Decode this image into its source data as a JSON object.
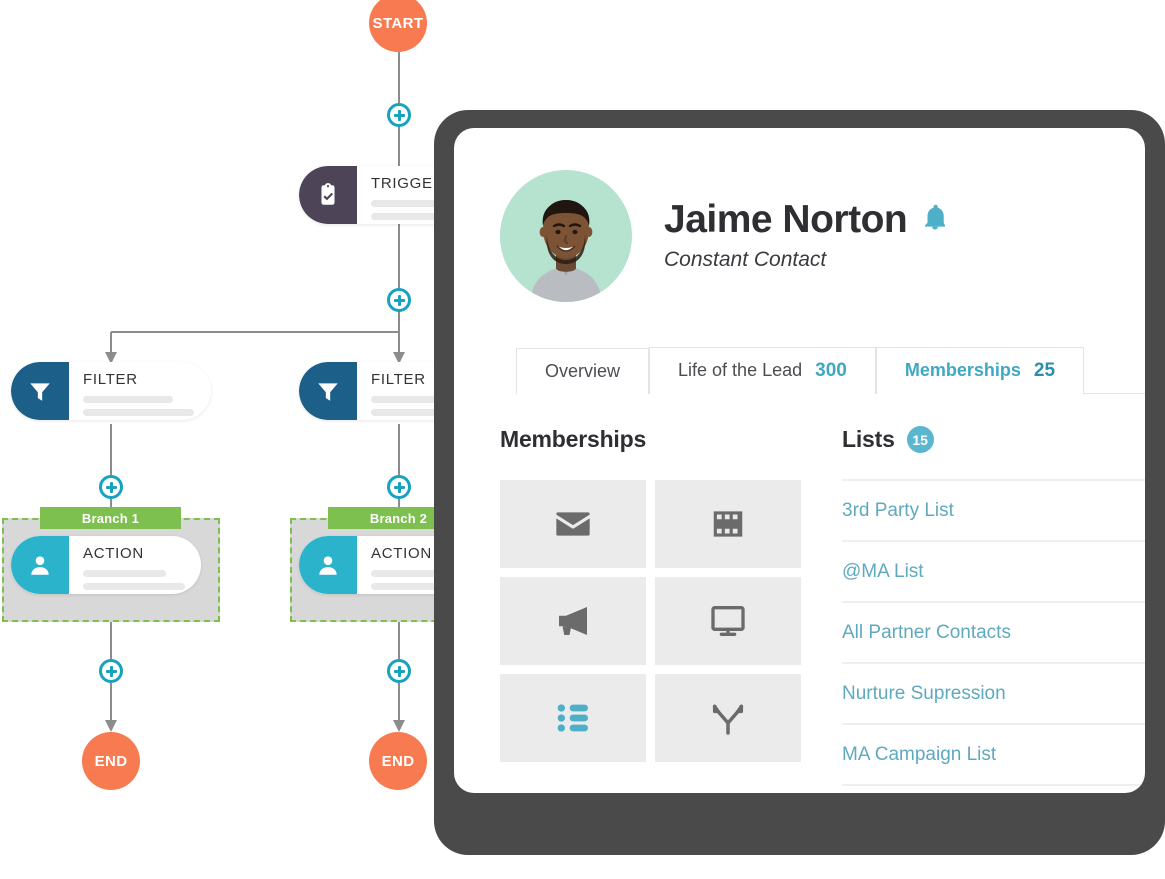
{
  "flow": {
    "start_label": "START",
    "end_label": "END",
    "nodes": [
      {
        "id": "trigger",
        "type": "TRIGGER",
        "icon": "clipboard-check-icon",
        "color": "#4e4458"
      },
      {
        "id": "filter-1",
        "type": "FILTER",
        "icon": "funnel-icon",
        "color": "#1c5f88"
      },
      {
        "id": "filter-2",
        "type": "FILTER",
        "icon": "funnel-icon",
        "color": "#1c5f88"
      },
      {
        "id": "action-1",
        "type": "ACTION",
        "icon": "person-icon",
        "color": "#2cb3cc"
      },
      {
        "id": "action-2",
        "type": "ACTION",
        "icon": "person-icon",
        "color": "#2cb3cc"
      }
    ],
    "branches": [
      {
        "id": "branch-1",
        "label": "Branch 1"
      },
      {
        "id": "branch-2",
        "label": "Branch 2"
      }
    ],
    "add_button_icon": "plus-circle-icon",
    "colors": {
      "terminal": "#f87a50",
      "branch": "#7ec04f",
      "accent": "#17a3c0",
      "connector": "#8c8c8c"
    }
  },
  "card": {
    "profile": {
      "avatar_icon": "user-photo-avatar",
      "name": "Jaime Norton",
      "bell_icon": "bell-icon",
      "subtitle": "Constant Contact"
    },
    "tabs": [
      {
        "label": "Overview",
        "count": "",
        "active": false
      },
      {
        "label": "Life of the Lead",
        "count": "300",
        "active": false
      },
      {
        "label": "Memberships",
        "count": "25",
        "active": true
      }
    ],
    "memberships": {
      "title": "Memberships",
      "tiles": [
        {
          "icon": "envelope-icon",
          "active": false
        },
        {
          "icon": "film-strip-icon",
          "active": false
        },
        {
          "icon": "megaphone-icon",
          "active": false
        },
        {
          "icon": "monitor-icon",
          "active": false
        },
        {
          "icon": "bulleted-list-icon",
          "active": true
        },
        {
          "icon": "fork-arrows-icon",
          "active": false
        }
      ]
    },
    "lists": {
      "title": "Lists",
      "count": "15",
      "items": [
        "3rd Party List",
        "@MA List",
        "All Partner Contacts",
        "Nurture Supression",
        "MA Campaign List"
      ]
    },
    "colors": {
      "bezel": "#4a4a4a",
      "accent": "#3fa8c4",
      "link": "#5fa9bf",
      "tile_bg": "#ebebeb",
      "avatar_bg": "#b5e3d0"
    }
  }
}
